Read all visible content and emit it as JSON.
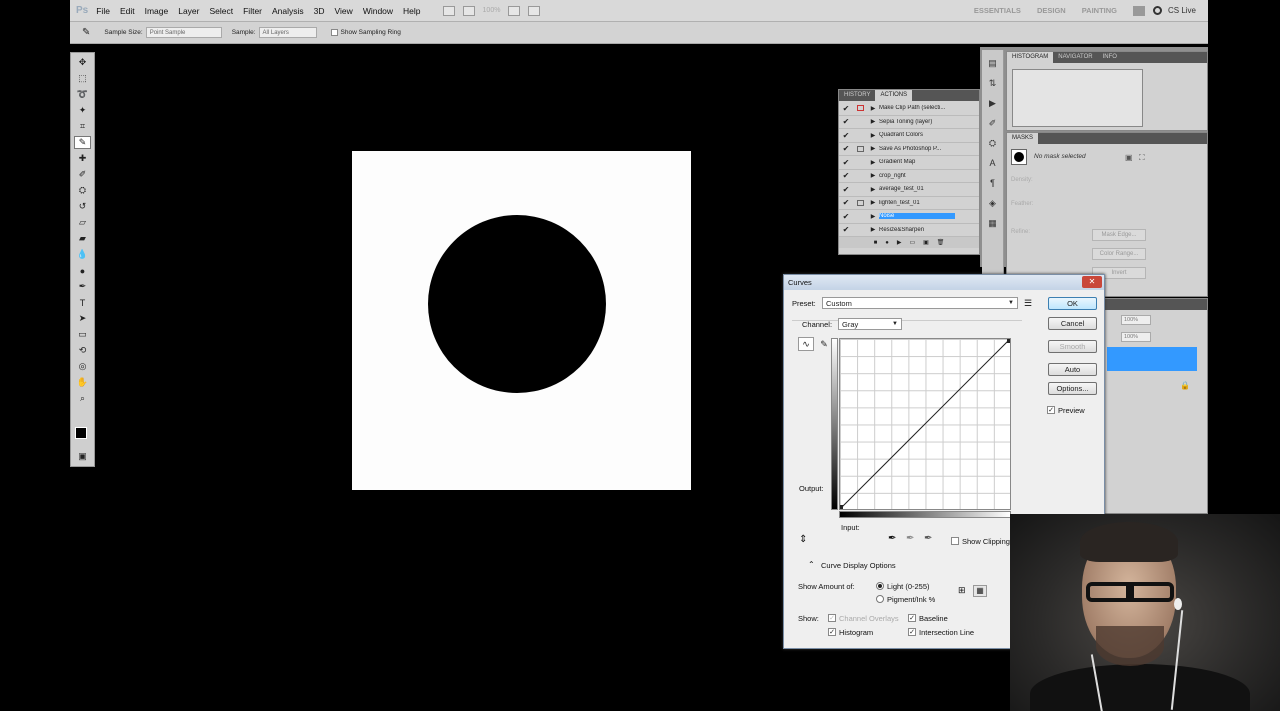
{
  "app": {
    "logo": "Ps"
  },
  "menubar": {
    "items": [
      "File",
      "Edit",
      "Image",
      "Layer",
      "Select",
      "Filter",
      "Analysis",
      "3D",
      "View",
      "Window",
      "Help"
    ],
    "zoom": "100%",
    "workspaces": [
      "ESSENTIALS",
      "DESIGN",
      "PAINTING"
    ],
    "cslive": "CS Live"
  },
  "options": {
    "sample_size_label": "Sample Size:",
    "sample_size_value": "Point Sample",
    "sample_label": "Sample:",
    "sample_value": "All Layers",
    "show_ring_label": "Show Sampling Ring"
  },
  "actions_panel": {
    "tabs": [
      "HISTORY",
      "ACTIONS"
    ],
    "items": [
      {
        "name": "Make Clip Path (selecti...",
        "dialog": true
      },
      {
        "name": "Sepia Toning (layer)",
        "dialog": false
      },
      {
        "name": "Quadrant Colors",
        "dialog": false
      },
      {
        "name": "Save As Photoshop P...",
        "dialog": true
      },
      {
        "name": "Gradient Map",
        "dialog": false
      },
      {
        "name": "crop_right",
        "dialog": false
      },
      {
        "name": "average_test_01",
        "dialog": false
      },
      {
        "name": "lighten_test_01",
        "dialog": true
      },
      {
        "name": "Noise",
        "dialog": false,
        "selected": true
      },
      {
        "name": "Resize&Sharpen",
        "dialog": false
      }
    ]
  },
  "histogram_panel": {
    "tabs": [
      "HISTOGRAM",
      "NAVIGATOR",
      "INFO"
    ]
  },
  "masks_panel": {
    "tab": "MASKS",
    "status": "No mask selected",
    "density": "Density:",
    "feather": "Feather:",
    "refine": "Refine:",
    "buttons": [
      "Mask Edge...",
      "Color Range...",
      "Invert"
    ]
  },
  "layers_panel": {
    "opacity": "100%",
    "fill": "100%"
  },
  "curves": {
    "title": "Curves",
    "preset_label": "Preset:",
    "preset_value": "Custom",
    "channel_label": "Channel:",
    "channel_value": "Gray",
    "ok": "OK",
    "cancel": "Cancel",
    "smooth": "Smooth",
    "auto": "Auto",
    "options": "Options...",
    "preview": "Preview",
    "output_label": "Output:",
    "input_label": "Input:",
    "show_clipping": "Show Clipping",
    "display_options": "Curve Display Options",
    "show_amount_label": "Show Amount of:",
    "light": "Light  (0-255)",
    "pigment": "Pigment/Ink %",
    "show_label": "Show:",
    "channel_overlays": "Channel Overlays",
    "baseline": "Baseline",
    "histogram": "Histogram",
    "intersection": "Intersection Line"
  }
}
